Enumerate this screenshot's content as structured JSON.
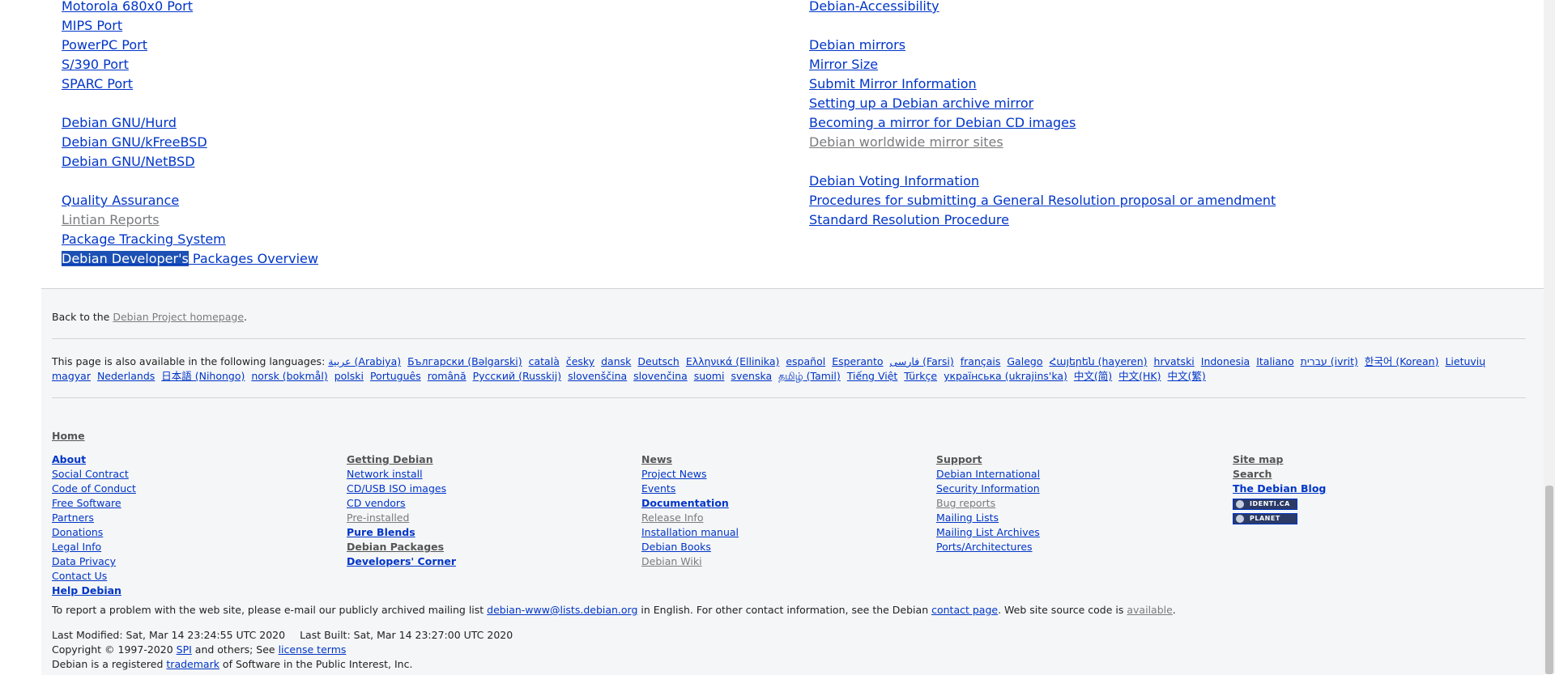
{
  "top_links": {
    "left": [
      [
        "Motorola 680x0 Port",
        "MIPS Port",
        "PowerPC Port",
        "S/390 Port",
        "SPARC Port"
      ],
      [
        "Debian GNU/Hurd",
        "Debian GNU/kFreeBSD",
        "Debian GNU/NetBSD"
      ],
      [
        "Quality Assurance",
        "Lintian Reports",
        "Package Tracking System"
      ]
    ],
    "selected_link": {
      "selected_part": "Debian Developer's",
      "rest": " Packages Overview"
    },
    "right": [
      [
        "Debian-Accessibility"
      ],
      [
        "Debian mirrors",
        "Mirror Size",
        "Submit Mirror Information",
        "Setting up a Debian archive mirror",
        "Becoming a mirror for Debian CD images",
        "Debian worldwide mirror sites"
      ],
      [
        "Debian Voting Information",
        "Procedures for submitting a General Resolution proposal or amendment",
        "Standard Resolution Procedure"
      ]
    ]
  },
  "footer": {
    "back": {
      "prefix": "Back to the ",
      "link": "Debian Project homepage",
      "suffix": "."
    },
    "languages_intro": "This page is also available in the following languages:",
    "languages": [
      "عربية (Arabiya)",
      "Български (Bəlgarski)",
      "català",
      "česky",
      "dansk",
      "Deutsch",
      "Ελληνικά (Ellinika)",
      "español",
      "Esperanto",
      "فارسی (Farsi)",
      "français",
      "Galego",
      "Հայերեն (hayeren)",
      "hrvatski",
      "Indonesia",
      "Italiano",
      "עברית (ivrit)",
      "한국어 (Korean)",
      "Lietuvių",
      "magyar",
      "Nederlands",
      "日本語 (Nihongo)",
      "norsk (bokmål)",
      "polski",
      "Português",
      "română",
      "Русский (Russkij)",
      "slovenščina",
      "slovenčina",
      "suomi",
      "svenska",
      "தமிழ் (Tamil)",
      "Tiếng Việt",
      "Türkçe",
      "українська (ukrajins'ka)",
      "中文(简)",
      "中文(HK)",
      "中文(繁)"
    ],
    "nav": {
      "home": "Home",
      "col1": [
        "About",
        "Social Contract",
        "Code of Conduct",
        "Free Software",
        "Partners",
        "Donations",
        "Legal Info",
        "Data Privacy",
        "Contact Us",
        "Help Debian"
      ],
      "col2": [
        "Getting Debian",
        "Network install",
        "CD/USB ISO images",
        "CD vendors",
        "Pre-installed",
        "Pure Blends",
        "Debian Packages",
        "Developers' Corner"
      ],
      "col3": [
        "News",
        "Project News",
        "Events",
        "Documentation",
        "Release Info",
        "Installation manual",
        "Debian Books",
        "Debian Wiki"
      ],
      "col4": [
        "Support",
        "Debian International",
        "Security Information",
        "Bug reports",
        "Mailing Lists",
        "Mailing List Archives",
        "Ports/Architectures"
      ],
      "col5": [
        "Site map",
        "Search",
        "The Debian Blog"
      ],
      "badges": [
        "IDENTI.CA",
        "PLANET"
      ]
    },
    "report": {
      "p1": "To report a problem with the web site, please e-mail our publicly archived mailing list ",
      "email": "debian-www@lists.debian.org",
      "p2": " in English. For other contact information, see the Debian ",
      "contact": "contact page",
      "p3": ". Web site source code is ",
      "available": "available",
      "p4": "."
    },
    "meta": {
      "modified": "Last Modified: Sat, Mar 14 23:24:55 UTC 2020",
      "built": "Last Built: Sat, Mar 14 23:27:00 UTC 2020",
      "copyright_prefix": "Copyright © 1997-2020 ",
      "spi": "SPI",
      "copyright_mid": " and others; See ",
      "license": "license terms",
      "trademark_prefix": "Debian is a registered ",
      "trademark": "trademark",
      "trademark_suffix": " of Software in the Public Interest, Inc."
    }
  },
  "colors": {
    "link": "#0035c7",
    "visited": "#7a7b7e",
    "selection": "#1c50b4",
    "footer_bg": "#f5f6f7"
  }
}
